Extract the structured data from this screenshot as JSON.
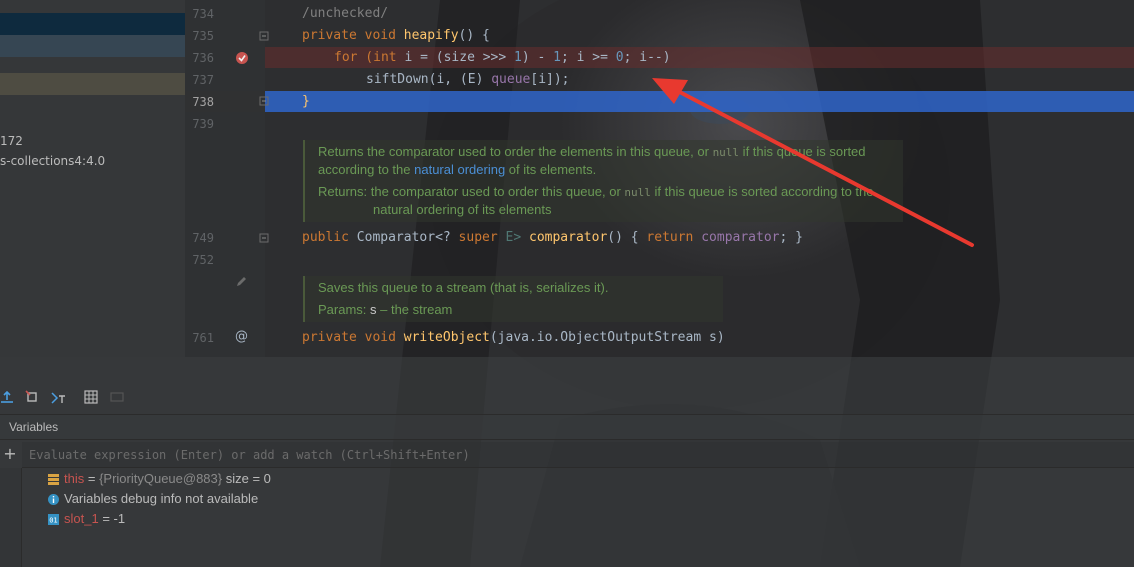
{
  "project_panel": {
    "item_172": "172",
    "item_collections": "s-collections4:4.0"
  },
  "editor": {
    "line_numbers": [
      "734",
      "735",
      "736",
      "737",
      "738",
      "739",
      "749",
      "752",
      "761"
    ],
    "lines": {
      "l734": "/unchecked/",
      "l735_kw": "private void ",
      "l735_fn": "heapify",
      "l735_rest": "() {",
      "l736_a": "for (",
      "l736_b": "int ",
      "l736_c": "i = (size >>> ",
      "l736_d": "1",
      "l736_e": ") - ",
      "l736_f": "1",
      "l736_g": "; i >= ",
      "l736_h": "0",
      "l736_i": "; i--)",
      "l737_a": "siftDown(i, (E) ",
      "l737_b": "queue",
      "l737_c": "[i]);",
      "l738": "}",
      "l749_kw": "public ",
      "l749_type": "Comparator<? ",
      "l749_super": "super ",
      "l749_e": "E> ",
      "l749_fn": "comparator",
      "l749_rest1": "() { ",
      "l749_ret": "return ",
      "l749_fld": "comparator",
      "l749_rest2": "; }",
      "l761_kw": "private void ",
      "l761_fn": "writeObject",
      "l761_rest": "(java.io.ObjectOutputStream s)"
    },
    "doc1": {
      "p1_a": "Returns the comparator used to order the elements in this queue, or ",
      "p1_null": "null",
      "p1_b": " if this queue is sorted",
      "p2_a": "according to the ",
      "p2_link": "natural ordering",
      "p2_b": " of its elements.",
      "p3_label": "Returns: ",
      "p3_a": "the comparator used to order this queue, or ",
      "p3_null": "null",
      "p3_b": " if this queue is sorted according to the",
      "p4": "natural ordering of its elements"
    },
    "doc2": {
      "p1": "Saves this queue to a stream (that is, serializes it).",
      "p2_label": "Params: ",
      "p2_s": "s",
      "p2_rest": " – the stream"
    }
  },
  "debugger": {
    "tab_label": "Variables",
    "eval_placeholder": "Evaluate expression (Enter) or add a watch (Ctrl+Shift+Enter)",
    "vars": [
      {
        "name": "this",
        "eq": " = ",
        "desc": "{PriorityQueue@883}",
        "extra": "  size = 0"
      },
      {
        "text": "Variables debug info not available"
      },
      {
        "name": "slot_1",
        "eq": " = ",
        "value": "-1"
      }
    ]
  },
  "colors": {
    "breakpoint_line": "#672d2d",
    "current_line": "#2f65ca",
    "arrow": "#e8392f"
  }
}
